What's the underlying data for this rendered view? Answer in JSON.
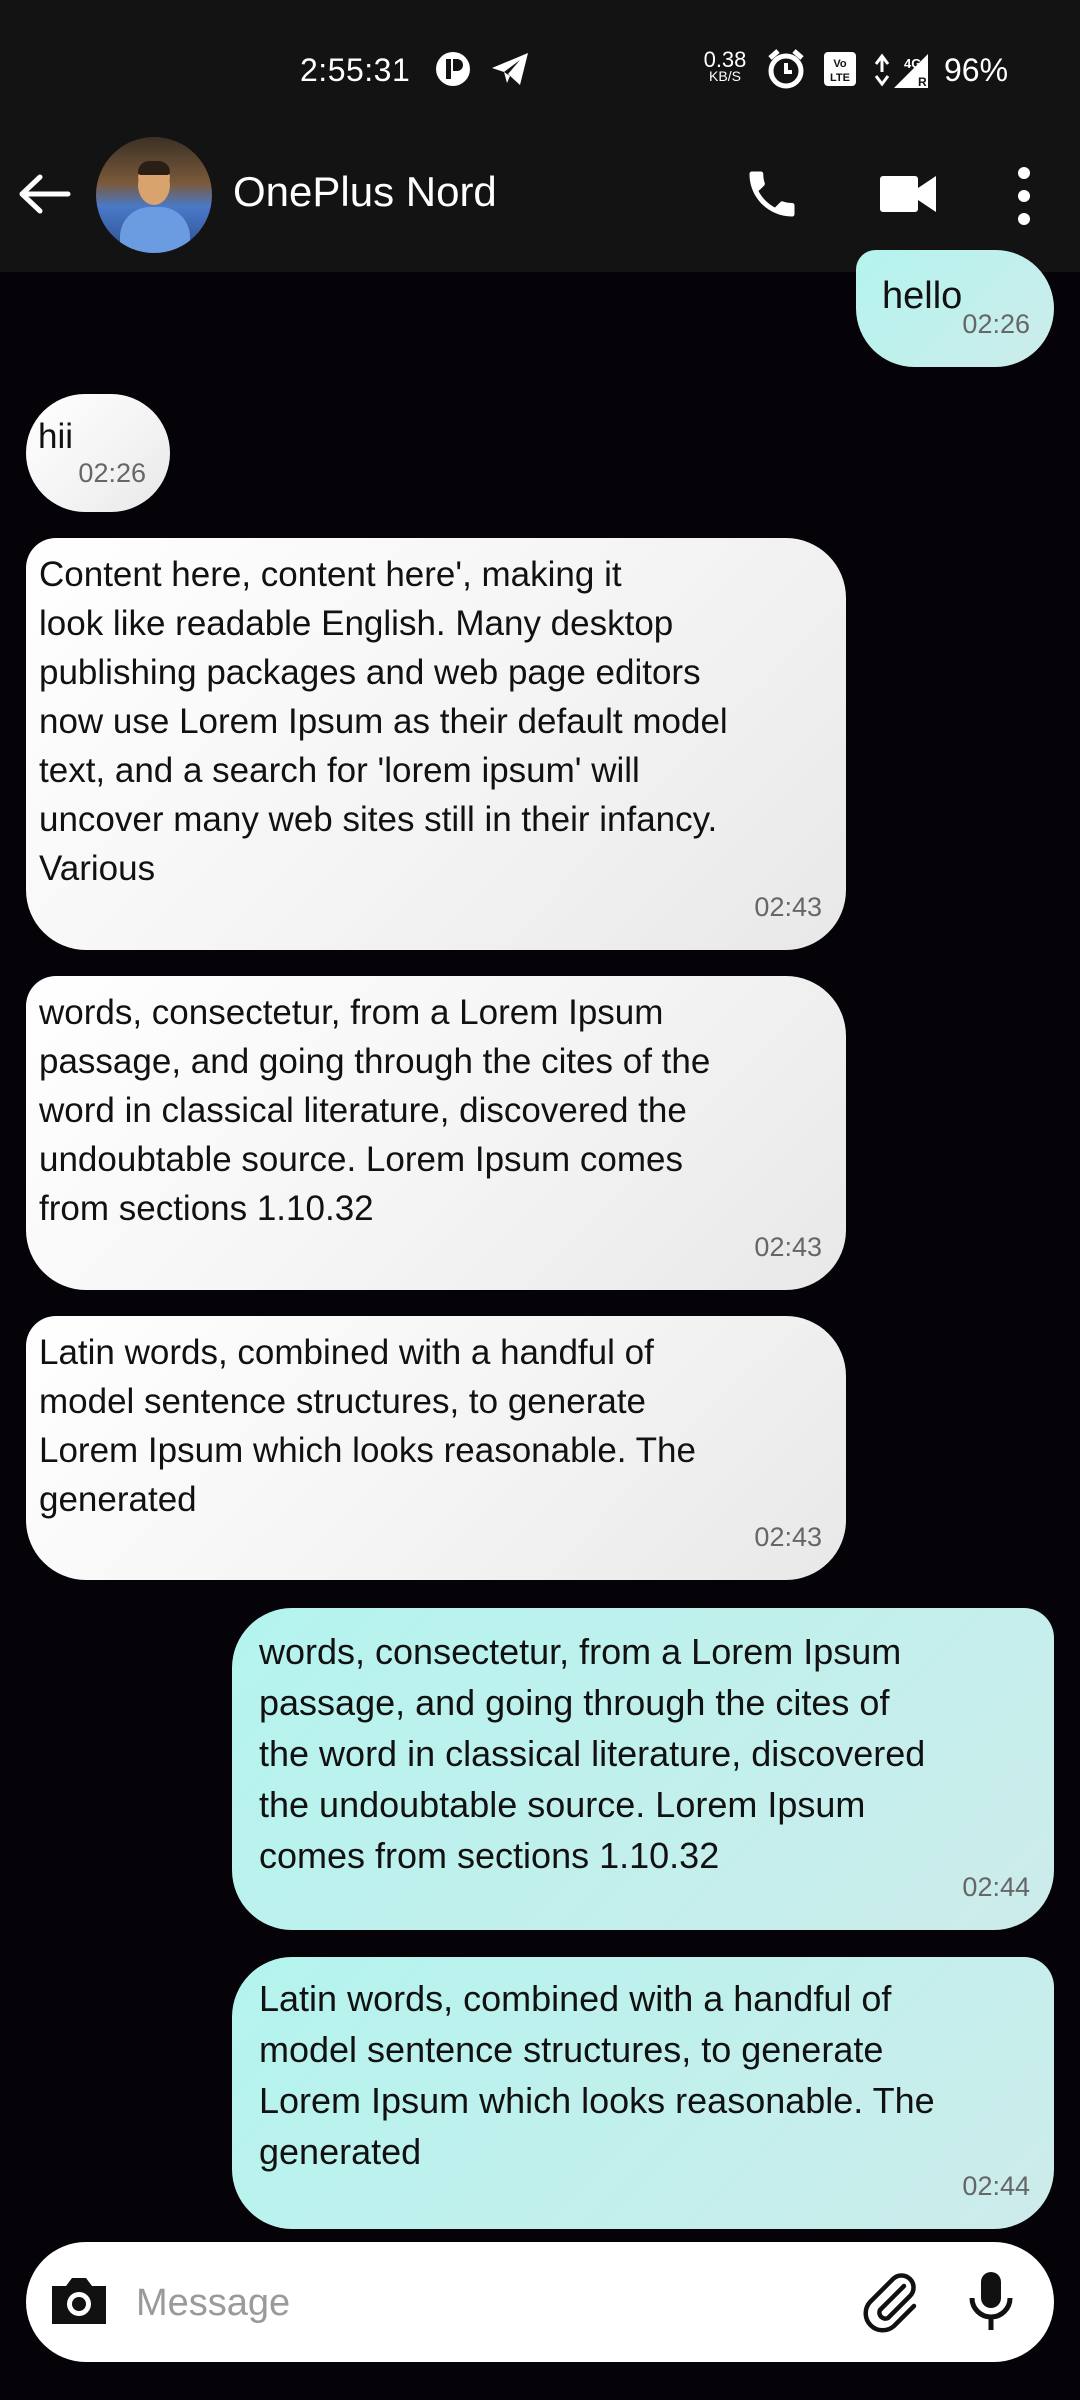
{
  "status_bar": {
    "time": "2:55:31",
    "net_speed": "0.38",
    "net_unit": "KB/S",
    "battery": "96%"
  },
  "header": {
    "contact_name": "OnePlus Nord"
  },
  "messages": [
    {
      "direction": "out",
      "text": "hello",
      "time": "02:26"
    },
    {
      "direction": "in",
      "text": "hii",
      "time": "02:26"
    },
    {
      "direction": "in",
      "text": "Content here, content here', making it\nlook like readable English. Many desktop\npublishing packages and web page editors\nnow use Lorem Ipsum as their default model\ntext, and a search for 'lorem ipsum' will\nuncover many web sites still in their infancy.\nVarious",
      "time": "02:43"
    },
    {
      "direction": "in",
      "text": "words, consectetur, from a Lorem Ipsum\npassage, and going through the cites of the\nword in classical literature, discovered the\nundoubtable source. Lorem Ipsum comes\nfrom sections 1.10.32",
      "time": "02:43"
    },
    {
      "direction": "in",
      "text": "Latin words, combined with a handful of\nmodel sentence structures, to generate\nLorem Ipsum which looks reasonable. The\ngenerated",
      "time": "02:43"
    },
    {
      "direction": "out",
      "text": "words, consectetur, from a Lorem Ipsum\npassage, and going through the cites of\nthe word in classical literature, discovered\nthe undoubtable source. Lorem Ipsum\ncomes from sections 1.10.32",
      "time": "02:44"
    },
    {
      "direction": "out",
      "text": "Latin words, combined with a handful of\nmodel sentence structures, to generate\nLorem Ipsum which looks reasonable. The\ngenerated",
      "time": "02:44"
    }
  ],
  "composer": {
    "placeholder": "Message"
  },
  "colors": {
    "bar_background": "#131313",
    "chat_background": "#050307",
    "outgoing_bubble": "#b4f4ee",
    "incoming_bubble": "#ffffff"
  }
}
